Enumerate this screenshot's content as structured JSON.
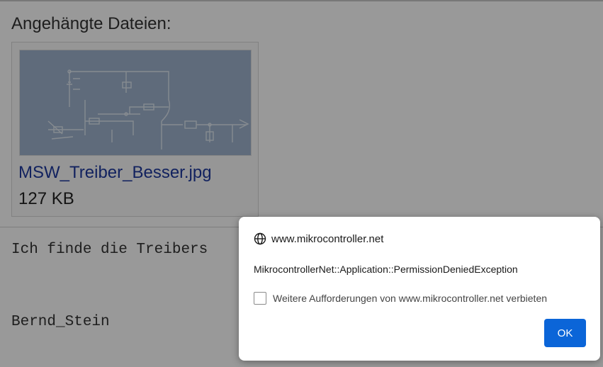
{
  "page": {
    "attachments_heading": "Angehängte Dateien:",
    "attachment": {
      "file_name": "MSW_Treiber_Besser.jpg",
      "file_size": "127 KB"
    },
    "post_text": "Ich finde die Treibers",
    "signature": "Bernd_Stein"
  },
  "dialog": {
    "origin": "www.mikrocontroller.net",
    "message": "MikrocontrollerNet::Application::PermissionDeniedException",
    "checkbox_label": "Weitere Aufforderungen von www.mikrocontroller.net verbieten",
    "checkbox_checked": false,
    "ok_label": "OK"
  },
  "colors": {
    "link": "#1f3a9e",
    "ok_button": "#0b65d8",
    "scrim": "rgba(0,0,0,0.40)"
  }
}
